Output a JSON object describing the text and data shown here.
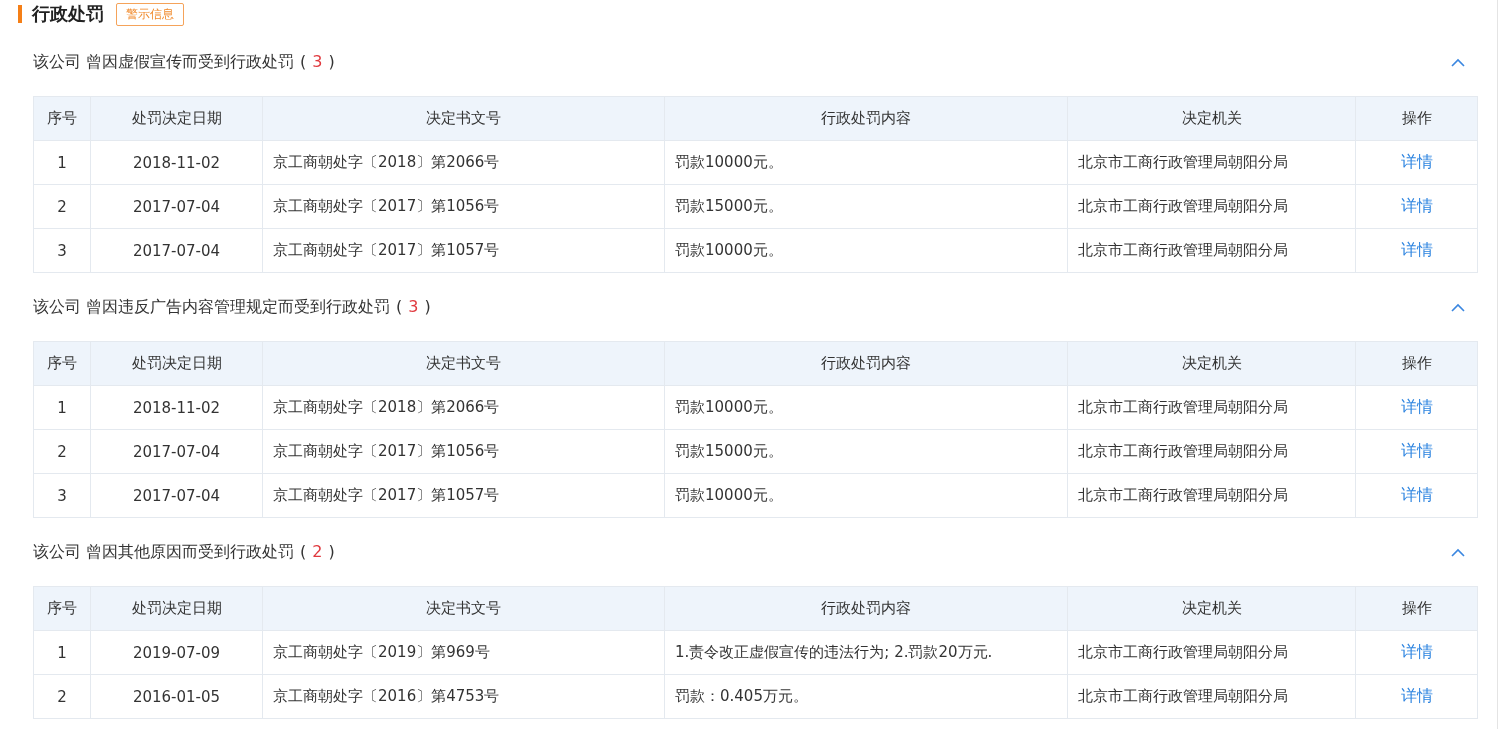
{
  "title": "行政处罚",
  "tag": "警示信息",
  "sections": [
    {
      "heading": "该公司 曾因虚假宣传而受到行政处罚",
      "paren_open": "(",
      "count": "3",
      "paren_close": ")",
      "expanded": true,
      "columns": [
        "序号",
        "处罚决定日期",
        "决定书文号",
        "行政处罚内容",
        "决定机关",
        "操作"
      ],
      "rows": [
        {
          "no": "1",
          "date": "2018-11-02",
          "doc": "京工商朝处字〔2018〕第2066号",
          "content": "罚款10000元。",
          "agency": "北京市工商行政管理局朝阳分局",
          "action": "详情"
        },
        {
          "no": "2",
          "date": "2017-07-04",
          "doc": "京工商朝处字〔2017〕第1056号",
          "content": "罚款15000元。",
          "agency": "北京市工商行政管理局朝阳分局",
          "action": "详情"
        },
        {
          "no": "3",
          "date": "2017-07-04",
          "doc": "京工商朝处字〔2017〕第1057号",
          "content": "罚款10000元。",
          "agency": "北京市工商行政管理局朝阳分局",
          "action": "详情"
        }
      ]
    },
    {
      "heading": "该公司 曾因违反广告内容管理规定而受到行政处罚",
      "paren_open": "(",
      "count": "3",
      "paren_close": ")",
      "expanded": true,
      "columns": [
        "序号",
        "处罚决定日期",
        "决定书文号",
        "行政处罚内容",
        "决定机关",
        "操作"
      ],
      "rows": [
        {
          "no": "1",
          "date": "2018-11-02",
          "doc": "京工商朝处字〔2018〕第2066号",
          "content": "罚款10000元。",
          "agency": "北京市工商行政管理局朝阳分局",
          "action": "详情"
        },
        {
          "no": "2",
          "date": "2017-07-04",
          "doc": "京工商朝处字〔2017〕第1056号",
          "content": "罚款15000元。",
          "agency": "北京市工商行政管理局朝阳分局",
          "action": "详情"
        },
        {
          "no": "3",
          "date": "2017-07-04",
          "doc": "京工商朝处字〔2017〕第1057号",
          "content": "罚款10000元。",
          "agency": "北京市工商行政管理局朝阳分局",
          "action": "详情"
        }
      ]
    },
    {
      "heading": "该公司 曾因其他原因而受到行政处罚",
      "paren_open": "(",
      "count": "2",
      "paren_close": ")",
      "expanded": true,
      "columns": [
        "序号",
        "处罚决定日期",
        "决定书文号",
        "行政处罚内容",
        "决定机关",
        "操作"
      ],
      "rows": [
        {
          "no": "1",
          "date": "2019-07-09",
          "doc": "京工商朝处字〔2019〕第969号",
          "content": "1.责令改正虚假宣传的违法行为; 2.罚款20万元.",
          "agency": "北京市工商行政管理局朝阳分局",
          "action": "详情"
        },
        {
          "no": "2",
          "date": "2016-01-05",
          "doc": "京工商朝处字〔2016〕第4753号",
          "content": "罚款：0.405万元。",
          "agency": "北京市工商行政管理局朝阳分局",
          "action": "详情"
        }
      ]
    }
  ]
}
